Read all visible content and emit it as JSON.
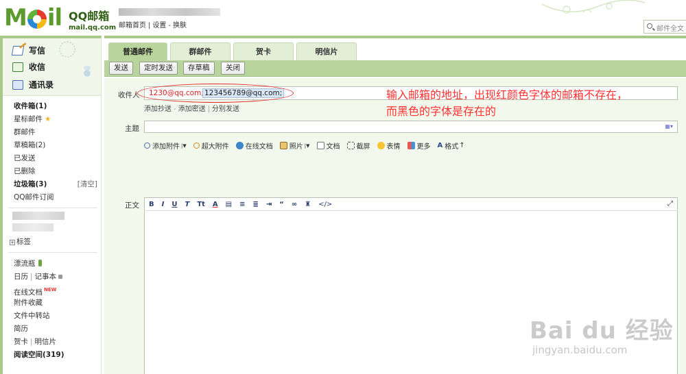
{
  "header": {
    "logo_text": "M  il",
    "brand_cn": "QQ邮箱",
    "brand_url": "mail.qq.com",
    "links": [
      "邮箱首页",
      "设置",
      "换肤"
    ],
    "search_placeholder": "邮件全文"
  },
  "sidebar": {
    "actions": [
      "写信",
      "收信",
      "通讯录"
    ],
    "folders": [
      {
        "label": "收件箱(1)",
        "bold": true
      },
      {
        "label": "星标邮件"
      },
      {
        "label": "群邮件"
      },
      {
        "label": "草稿箱(2)"
      },
      {
        "label": "已发送"
      },
      {
        "label": "已删除"
      },
      {
        "label": "垃圾箱(3)",
        "bold": true,
        "right": "[清空]"
      },
      {
        "label": "QQ邮件订阅"
      }
    ],
    "tags_label": "标签",
    "apps": [
      "漂流瓶",
      "日历",
      "记事本",
      "在线文档",
      "附件收藏",
      "文件中转站",
      "简历",
      "贺卡",
      "明信片",
      "阅读空间(319)"
    ],
    "new_badge": "NEW"
  },
  "tabs": [
    "普通邮件",
    "群邮件",
    "贺卡",
    "明信片"
  ],
  "toolbar": [
    "发送",
    "定时发送",
    "存草稿",
    "关闭"
  ],
  "compose": {
    "to_label": "收件人",
    "recipients": [
      {
        "address": "1230@qq.com;",
        "exists": false
      },
      {
        "address": "123456789@qq.com;",
        "exists": true
      }
    ],
    "add_cc": "添加抄送",
    "add_bcc": "添加密送",
    "separate_send": "分别发送",
    "subject_label": "主题",
    "attach_tools": [
      "添加附件",
      "超大附件",
      "在线文档",
      "照片",
      "文档",
      "截屏",
      "表情",
      "更多",
      "格式"
    ],
    "body_label": "正文",
    "rte_buttons": [
      "B",
      "I",
      "U",
      "T",
      "Tt",
      "A",
      "≡",
      "≣",
      "“",
      "</>"
    ]
  },
  "annotation": {
    "line1": "输入邮箱的地址，出现红颜色字体的邮箱不存在，",
    "line2": "而黑色的字体是存在的"
  },
  "watermark": {
    "big": "Bai  du 经验",
    "small": "jingyan.baidu.com"
  },
  "colors": {
    "accent_green": "#a9c98a",
    "toolbar_green": "#b9d59d",
    "compose_bg": "#f2f8ec",
    "invalid_red": "#e02020",
    "annotation_red": "#ff3030"
  }
}
